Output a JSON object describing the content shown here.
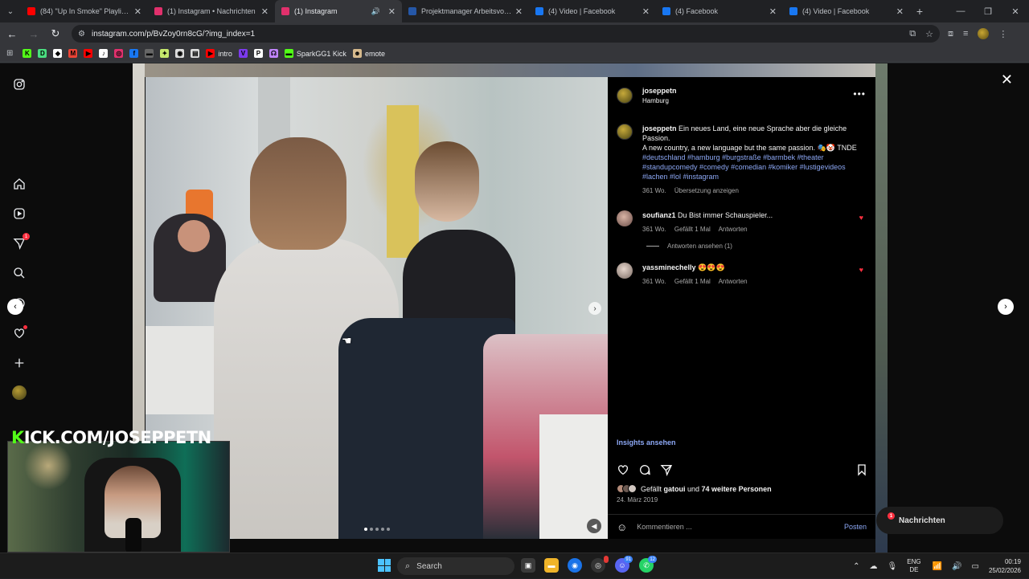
{
  "tabs": [
    {
      "title": "(84) \"Up In Smoke\" Playlist — d",
      "icon": "youtube-icon",
      "color": "#ff0000"
    },
    {
      "title": "(1) Instagram • Nachrichten",
      "icon": "instagram-icon",
      "color": "#e1306c"
    },
    {
      "title": "(1) Instagram",
      "icon": "instagram-icon",
      "color": "#e1306c",
      "active": true
    },
    {
      "title": "Projektmanager Arbeitsvorbere",
      "icon": "indeed-icon",
      "color": "#2557a7"
    },
    {
      "title": "(4) Video | Facebook",
      "icon": "facebook-icon",
      "color": "#1877f2"
    },
    {
      "title": "(4) Facebook",
      "icon": "facebook-icon",
      "color": "#1877f2"
    },
    {
      "title": "(4) Video | Facebook",
      "icon": "facebook-icon",
      "color": "#1877f2"
    }
  ],
  "address": {
    "url": "instagram.com/p/BvZoy0rn8cG/?img_index=1"
  },
  "bookmarks": [
    {
      "label": "",
      "icon": "kick-icon",
      "color": "#53fc18",
      "glyph": "K"
    },
    {
      "label": "",
      "icon": "d-icon",
      "color": "#4ade80",
      "glyph": "D"
    },
    {
      "label": "",
      "icon": "diamond-icon",
      "color": "#ffffff",
      "glyph": "◆"
    },
    {
      "label": "",
      "icon": "gmail-icon",
      "color": "#ea4335",
      "glyph": "M"
    },
    {
      "label": "",
      "icon": "youtube-icon",
      "color": "#ff0000",
      "glyph": "▶"
    },
    {
      "label": "",
      "icon": "tiktok-icon",
      "color": "#ffffff",
      "glyph": "♪"
    },
    {
      "label": "",
      "icon": "instagram-icon",
      "color": "#e1306c",
      "glyph": "◎"
    },
    {
      "label": "",
      "icon": "facebook-icon",
      "color": "#1877f2",
      "glyph": "f"
    },
    {
      "label": "",
      "icon": "game-icon",
      "color": "#666666",
      "glyph": "▬"
    },
    {
      "label": "",
      "icon": "leaf-icon",
      "color": "#c5e86c",
      "glyph": "✦"
    },
    {
      "label": "",
      "icon": "chatgpt-icon",
      "color": "#dddddd",
      "glyph": "◉"
    },
    {
      "label": "",
      "icon": "doc-icon",
      "color": "#dddddd",
      "glyph": "▤"
    },
    {
      "label": "intro",
      "icon": "youtube-icon",
      "color": "#ff0000",
      "glyph": "▶"
    },
    {
      "label": "",
      "icon": "vimeo-icon",
      "color": "#7c3aed",
      "glyph": "V"
    },
    {
      "label": "",
      "icon": "p-icon",
      "color": "#ffffff",
      "glyph": "P"
    },
    {
      "label": "",
      "icon": "twitch-icon",
      "color": "#c084fc",
      "glyph": "☊"
    },
    {
      "label": "SparkGG1 Kick",
      "icon": "kick-small-icon",
      "color": "#53fc18",
      "glyph": "▬"
    },
    {
      "label": "emote",
      "icon": "emote-icon",
      "color": "#d6b98c",
      "glyph": "☻"
    }
  ],
  "post": {
    "username": "joseppetn",
    "location": "Hamburg",
    "caption_line1": "Ein neues Land, eine neue Sprache aber die gleiche Passion.",
    "caption_line2": "A new country, a new language but the same passion. 🎭🤡 TNDE",
    "hashtags": "#deutschland #hamburg #burgstraße #barmbek #theater #standupcomedy #comedy #comedian #komiker #lustigevideos #lachen #lol #instagram",
    "age": "361 Wo.",
    "translate": "Übersetzung anzeigen",
    "insights": "Insights ansehen",
    "likes_prefix": "Gefällt ",
    "likes_user": "gatoui",
    "likes_mid": " und ",
    "likes_others": "74 weitere Personen",
    "date": "24. März 2019",
    "comment_placeholder": "Kommentieren ...",
    "post_button": "Posten"
  },
  "comments": [
    {
      "user": "soufianz1",
      "text": "Du Bist immer Schauspieler...",
      "age": "361 Wo.",
      "likes": "Gefällt 1 Mal",
      "reply": "Antworten",
      "view_replies": "Antworten ansehen (1)"
    },
    {
      "user": "yassminechelly",
      "text": "😍😍😍",
      "age": "361 Wo.",
      "likes": "Gefällt 1 Mal",
      "reply": "Antworten"
    }
  ],
  "messages": {
    "label": "Nachrichten",
    "badge": "1"
  },
  "sidebar": {
    "notification_badge": "1"
  },
  "overlay": {
    "kick_prefix": "K",
    "kick_rest": "ICK.COM/JOSEPPETN"
  },
  "taskbar": {
    "search_label": "Search",
    "discord_badge": "91",
    "whatsapp_badge": "12",
    "lang_top": "ENG",
    "lang_bottom": "DE",
    "time": "00:19",
    "date": "25/02/2026"
  },
  "media": {
    "page_count": 5,
    "current_index": 0
  }
}
